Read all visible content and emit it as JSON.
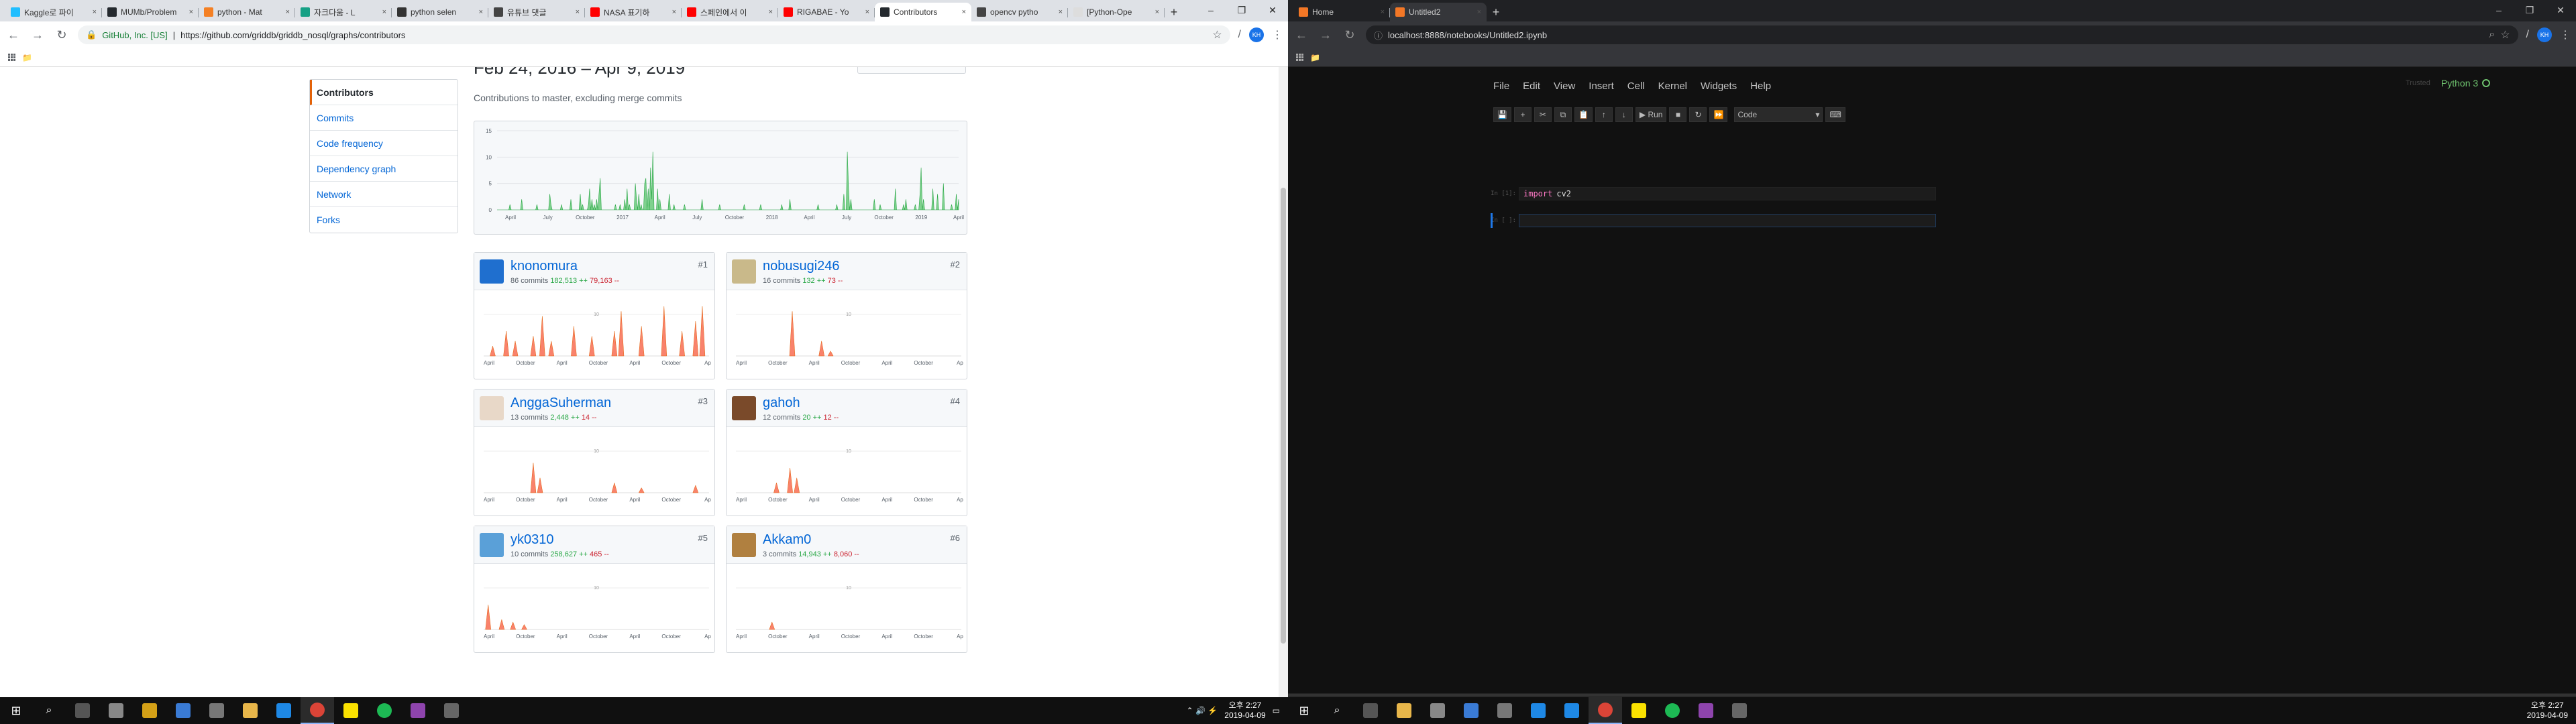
{
  "left": {
    "tabs": [
      {
        "title": "Kaggle로 파이",
        "color": "#20beff",
        "active": false
      },
      {
        "title": "MUMb/Problem",
        "color": "#24292e",
        "active": false
      },
      {
        "title": "python - Mat",
        "color": "#f48024",
        "active": false
      },
      {
        "title": "자크다움 - L",
        "color": "#16a085",
        "active": false
      },
      {
        "title": "python selen",
        "color": "#333333",
        "active": false
      },
      {
        "title": "유튜브 댓글",
        "color": "#444444",
        "active": false
      },
      {
        "title": "NASA 표기하",
        "color": "#ff0000",
        "active": false
      },
      {
        "title": "스페인에서 이",
        "color": "#ff0000",
        "active": false
      },
      {
        "title": "RIGABAE - Yo",
        "color": "#ff0000",
        "active": false
      },
      {
        "title": "Contributors",
        "color": "#24292e",
        "active": true
      },
      {
        "title": "opencv pytho",
        "color": "#444444",
        "active": false
      },
      {
        "title": "[Python-Ope",
        "color": "#dddddd",
        "active": false
      }
    ],
    "site_label": "GitHub, Inc. [US]",
    "url": "https://github.com/griddb/griddb_nosql/graphs/contributors",
    "profile_initials": "KH",
    "sidenav": [
      {
        "label": "Contributors",
        "selected": true
      },
      {
        "label": "Commits",
        "selected": false
      },
      {
        "label": "Code frequency",
        "selected": false
      },
      {
        "label": "Dependency graph",
        "selected": false
      },
      {
        "label": "Network",
        "selected": false
      },
      {
        "label": "Forks",
        "selected": false
      }
    ],
    "date_range": "Feb 24, 2016 – Apr 9, 2019",
    "subtitle": "Contributions to master, excluding merge commits"
  },
  "contributors": [
    {
      "login": "knonomura",
      "commits": "86 commits",
      "additions": "182,513 ++",
      "deletions": "79,163 --",
      "rank": "#1",
      "avatar_color": "#1f6fcf",
      "ymax": "10"
    },
    {
      "login": "nobusugi246",
      "commits": "16 commits",
      "additions": "132 ++",
      "deletions": "73 --",
      "rank": "#2",
      "avatar_color": "#c9b98a",
      "ymax": "10"
    },
    {
      "login": "AnggaSuherman",
      "commits": "13 commits",
      "additions": "2,448 ++",
      "deletions": "14 --",
      "rank": "#3",
      "avatar_color": "#e8d8c8",
      "ymax": "10"
    },
    {
      "login": "gahoh",
      "commits": "12 commits",
      "additions": "20 ++",
      "deletions": "12 --",
      "rank": "#4",
      "avatar_color": "#7a4a2a",
      "ymax": "10"
    },
    {
      "login": "yk0310",
      "commits": "10 commits",
      "additions": "258,627 ++",
      "deletions": "465 --",
      "rank": "#5",
      "avatar_color": "#5aa0d8",
      "ymax": "10"
    },
    {
      "login": "Akkam0",
      "commits": "3 commits",
      "additions": "14,943 ++",
      "deletions": "8,060 --",
      "rank": "#6",
      "avatar_color": "#b08040",
      "ymax": "10"
    }
  ],
  "chart_data": [
    {
      "type": "area",
      "title": "",
      "ylim": [
        0,
        15
      ],
      "yticks": [
        "0",
        "5",
        "10",
        "15"
      ],
      "xticks": [
        "April",
        "July",
        "October",
        "2017",
        "April",
        "July",
        "October",
        "2018",
        "April",
        "July",
        "October",
        "2019",
        "April"
      ],
      "series": [
        {
          "values": [
            0,
            0,
            0,
            0,
            0,
            0,
            0,
            0,
            0,
            0,
            0,
            1,
            0,
            0,
            0,
            0,
            0,
            0,
            0,
            0,
            0,
            2,
            0,
            0,
            0,
            0,
            0,
            0,
            0,
            0,
            0,
            0,
            0,
            0,
            1,
            0,
            0,
            0,
            0,
            0,
            0,
            0,
            0,
            0,
            0,
            3,
            1,
            0,
            0,
            0,
            0,
            0,
            0,
            0,
            0,
            1,
            0,
            0,
            0,
            0,
            0,
            0,
            0,
            2,
            0,
            0,
            0,
            0,
            0,
            0,
            0,
            3,
            0,
            1,
            0,
            0,
            0,
            0,
            1,
            4,
            0,
            2,
            0,
            1,
            0,
            2,
            0,
            3,
            6,
            0,
            0,
            0,
            0,
            0,
            0,
            0,
            0,
            0,
            0,
            0,
            0,
            1,
            0,
            0,
            0,
            1,
            0,
            0,
            0,
            2,
            0,
            4,
            0,
            1,
            0,
            0,
            0,
            0,
            5,
            2,
            0,
            3,
            0,
            1,
            0,
            0,
            5,
            6,
            0,
            4,
            0,
            8,
            2,
            11,
            0,
            0,
            0,
            4,
            0,
            2,
            0,
            0,
            0,
            0,
            0,
            0,
            0,
            3,
            0,
            0,
            0,
            1,
            0,
            0,
            0,
            0,
            0,
            0,
            0,
            0,
            1,
            0,
            0,
            0,
            0,
            0,
            0,
            0,
            0,
            0,
            0,
            0,
            0,
            0,
            0,
            2,
            0,
            0,
            0,
            0,
            0,
            0,
            0,
            0,
            0,
            0,
            0,
            0,
            0,
            0,
            1,
            0,
            0,
            0,
            0,
            0,
            0,
            0,
            0,
            0,
            0,
            0,
            0,
            0,
            0,
            0,
            0,
            0,
            0,
            0,
            0,
            1,
            0,
            0,
            0,
            0,
            0,
            0,
            0,
            0,
            0,
            0,
            0,
            0,
            0,
            1,
            0,
            0,
            0,
            0,
            0,
            0,
            0,
            0,
            0,
            0,
            0,
            0,
            0,
            0,
            0,
            0,
            0,
            1,
            0,
            0,
            0,
            0,
            0,
            0,
            2,
            0,
            0,
            0,
            0,
            0,
            0,
            0,
            0,
            0,
            0,
            0,
            0,
            0,
            0,
            0,
            0,
            0,
            0,
            0,
            0,
            0,
            0,
            0,
            1,
            0,
            0,
            0,
            0,
            0,
            0,
            0,
            0,
            0,
            0,
            0,
            0,
            0,
            0,
            0,
            1,
            0,
            0,
            0,
            0,
            0,
            3,
            0,
            0,
            11,
            4,
            0,
            2,
            0,
            0,
            0,
            0,
            0,
            0,
            0,
            0,
            0,
            0,
            0,
            0,
            0,
            0,
            0,
            0,
            0,
            0,
            0,
            2,
            0,
            0,
            0,
            0,
            1,
            0,
            0,
            0,
            0,
            0,
            0,
            0,
            0,
            0,
            0,
            0,
            0,
            4,
            0,
            0,
            0,
            0,
            0,
            0,
            1,
            0,
            2,
            0,
            0,
            0,
            0,
            0,
            0,
            0,
            1,
            0,
            0,
            0,
            3,
            8,
            0,
            2,
            0,
            0,
            0,
            0,
            0,
            0,
            0,
            4,
            0,
            0,
            0,
            3,
            0,
            0,
            0,
            0,
            5,
            0,
            0,
            0,
            0,
            0,
            0,
            1,
            0,
            0,
            0,
            3,
            0,
            2
          ]
        }
      ]
    }
  ],
  "right": {
    "tabs": [
      {
        "title": "Home",
        "color": "#f37726",
        "active": false
      },
      {
        "title": "Untitled2",
        "color": "#f37726",
        "active": true
      }
    ],
    "url": "localhost:8888/notebooks/Untitled2.ipynb",
    "profile_initials": "KH",
    "menu": [
      "File",
      "Edit",
      "View",
      "Insert",
      "Cell",
      "Kernel",
      "Widgets",
      "Help"
    ],
    "trusted": "Trusted",
    "kernel_name": "Python 3",
    "toolbar": [
      "💾",
      "+",
      "✂",
      "⧉",
      "📋",
      "↑",
      "↓",
      "▶ Run",
      "■",
      "↻",
      "⏩"
    ],
    "cell_type": "Code",
    "cells": [
      {
        "prompt": "In [1]:",
        "keyword": "import",
        "code": "cv2"
      },
      {
        "prompt": "In [ ]:",
        "keyword": "",
        "code": ""
      }
    ]
  },
  "taskbar": {
    "time": "오후 2:27",
    "date": "2019-04-09"
  }
}
